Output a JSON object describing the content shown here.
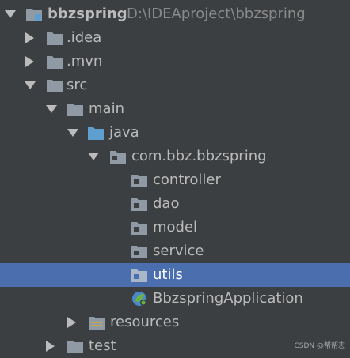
{
  "project_tree": {
    "root": {
      "name": "bbzspring",
      "path": "D:\\IDEAproject\\bbzspring"
    },
    "items": [
      {
        "label": ".idea"
      },
      {
        "label": ".mvn"
      },
      {
        "label": "src"
      },
      {
        "label": "main"
      },
      {
        "label": "java"
      },
      {
        "label": "com.bbz.bbzspring"
      },
      {
        "label": "controller"
      },
      {
        "label": "dao"
      },
      {
        "label": "model"
      },
      {
        "label": "service"
      },
      {
        "label": "utils"
      },
      {
        "label": "BbzspringApplication"
      },
      {
        "label": "resources"
      },
      {
        "label": "test"
      }
    ],
    "selected": "utils"
  },
  "icons": {
    "folder": "folder-icon",
    "module": "module-folder-icon",
    "source_root": "source-root-folder-icon",
    "package": "package-icon",
    "resources": "resources-folder-icon",
    "spring_boot": "spring-boot-class-icon"
  },
  "colors": {
    "background": "#3c3f41",
    "selection": "#4b6eaf",
    "text": "#bbbbbb",
    "folder": "#8f9aa5",
    "source_root": "#5f9fd0",
    "spring": "#6db33f"
  },
  "watermark": "CSDN @帮帮志"
}
